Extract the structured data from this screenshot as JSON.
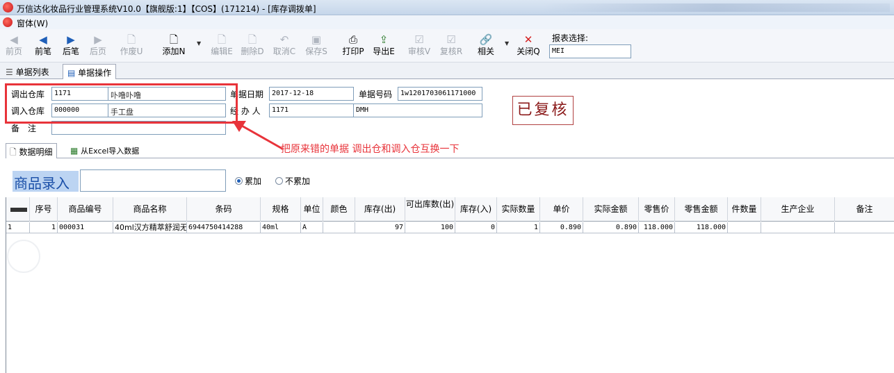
{
  "window": {
    "title": "万信达化妆品行业管理系统V10.0【旗舰版:1】【COS】(171214) - [库存调拨单]"
  },
  "menu": {
    "label": "窗体(W)"
  },
  "toolbar": {
    "prev_page": "前页",
    "prev_record": "前笔",
    "next_record": "后笔",
    "next_page": "后页",
    "void": "作废U",
    "add": "添加N",
    "edit": "编辑E",
    "delete": "删除D",
    "cancel": "取消C",
    "save": "保存S",
    "print": "打印P",
    "export": "导出E",
    "audit": "审核V",
    "recheck": "复核R",
    "related": "相关",
    "close": "关闭Q",
    "report_label": "报表选择:",
    "report_value": "MEI"
  },
  "tabs": {
    "list": "单据列表",
    "operation": "单据操作"
  },
  "form": {
    "out_wh_label": "调出仓库",
    "out_wh_code": "1171",
    "out_wh_name": "卟噜卟噜",
    "in_wh_label": "调入仓库",
    "in_wh_code": "000000",
    "in_wh_name": "手工盘",
    "note_label": "备　注",
    "date_label": "单据日期",
    "date_value": "2017-12-18",
    "docno_label": "单据号码",
    "docno_value": "1w1201703061171000",
    "handler_label": "经 办 人",
    "handler_code": "1171",
    "handler_name": "DMH",
    "status_stamp": "已复核"
  },
  "annotation": "把原来错的单据 调出仓和调入仓互换一下",
  "subtabs": {
    "detail": "数据明细",
    "excel": "从Excel导入数据"
  },
  "entry": {
    "label": "商品录入",
    "radio_add": "累加",
    "radio_noadd": "不累加"
  },
  "grid": {
    "headers": [
      "序号",
      "商品编号",
      "商品名称",
      "条码",
      "规格",
      "单位",
      "颜色",
      "库存(出)",
      "可出库数(出)",
      "库存(入)",
      "实际数量",
      "单价",
      "实际金额",
      "零售价",
      "零售金额",
      "件数量",
      "生产企业",
      "备注"
    ],
    "rows": [
      {
        "rownum": "1",
        "seq": "1",
        "code": "000031",
        "name": "40ml汉方精萃舒润无",
        "barcode": "6944750414288",
        "spec": "40ml",
        "unit": "A",
        "color": "",
        "stock_out": "97",
        "avail_out": "100",
        "stock_in": "0",
        "qty": "1",
        "price": "0.890",
        "amount": "0.890",
        "retail": "118.000",
        "retail_amt": "118.000",
        "pieces": "",
        "maker": "",
        "remark": ""
      }
    ]
  }
}
